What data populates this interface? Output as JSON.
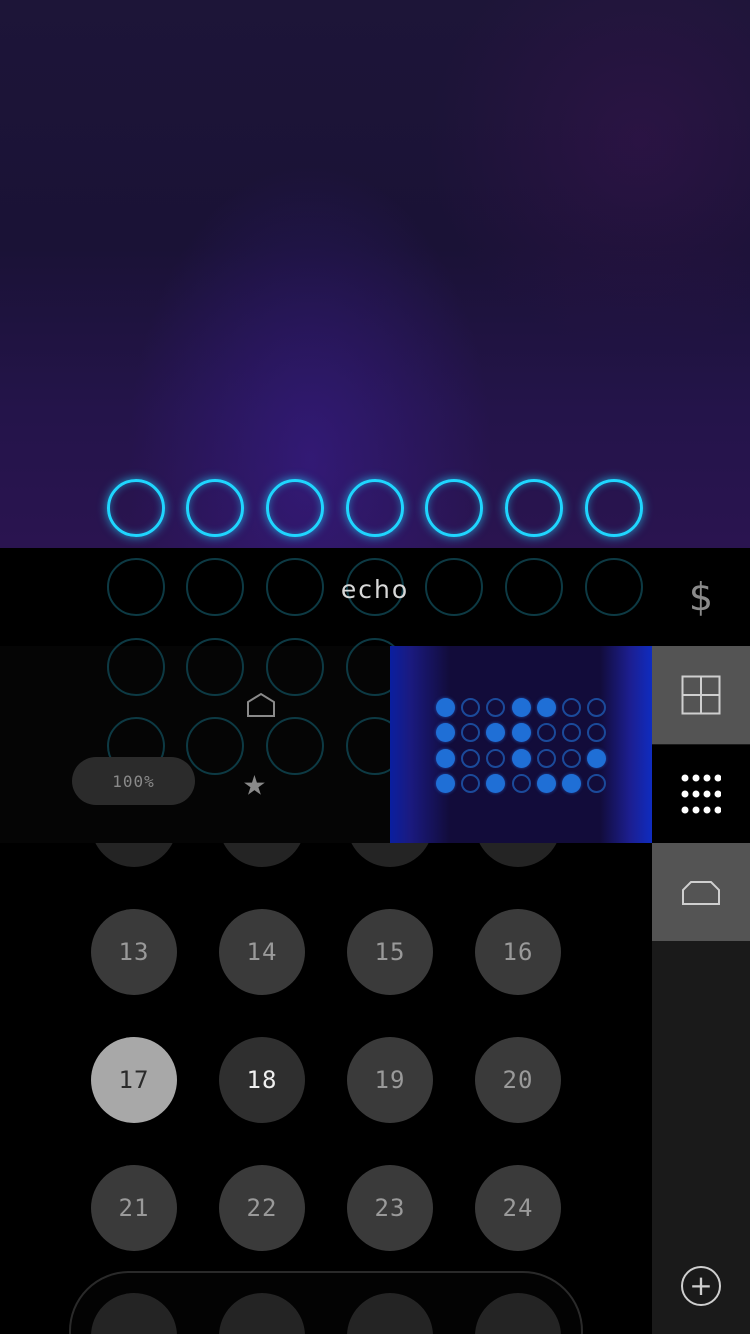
{
  "visualizer": {
    "ring_rows": [
      {
        "lit": true,
        "count": 7
      },
      {
        "lit": false,
        "count": 7
      },
      {
        "lit": false,
        "count": 7
      },
      {
        "lit": false,
        "count": 7
      }
    ]
  },
  "preset": {
    "name": "echo"
  },
  "controls": {
    "zoom_label": "100%",
    "home_icon": "home-icon",
    "favorite_icon": "star-icon",
    "star_glyph": "★"
  },
  "pattern_preview": {
    "rows": [
      [
        1,
        0,
        0,
        1,
        1,
        0,
        0
      ],
      [
        1,
        0,
        1,
        1,
        0,
        0,
        0
      ],
      [
        1,
        0,
        0,
        1,
        0,
        0,
        1
      ],
      [
        1,
        0,
        1,
        0,
        1,
        1,
        0
      ]
    ],
    "on_color": "#1f6fd6"
  },
  "pads": [
    {
      "label": "13",
      "state": "normal"
    },
    {
      "label": "14",
      "state": "normal"
    },
    {
      "label": "15",
      "state": "normal"
    },
    {
      "label": "16",
      "state": "normal"
    },
    {
      "label": "17",
      "state": "selected"
    },
    {
      "label": "18",
      "state": "active"
    },
    {
      "label": "19",
      "state": "normal"
    },
    {
      "label": "20",
      "state": "normal"
    },
    {
      "label": "21",
      "state": "normal"
    },
    {
      "label": "22",
      "state": "normal"
    },
    {
      "label": "23",
      "state": "normal"
    },
    {
      "label": "24",
      "state": "normal"
    }
  ],
  "sidebar": {
    "dollar_glyph": "$",
    "add_glyph": "+",
    "items": [
      "dollar-icon",
      "grid-icon",
      "pads-icon",
      "tray-icon",
      "add-icon"
    ]
  },
  "colors": {
    "ring_lit": "#1fd6ff",
    "ring_dim": "#0d3a44",
    "pad_bg": "#3a3a3a",
    "pad_selected": "#a8a8a8"
  }
}
